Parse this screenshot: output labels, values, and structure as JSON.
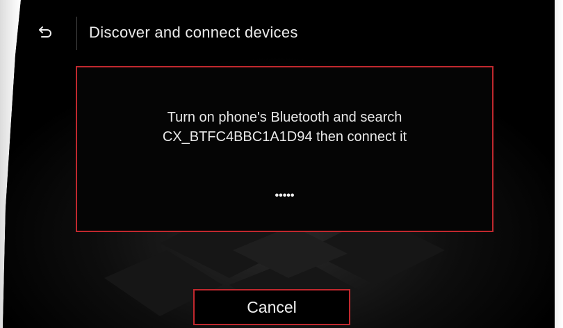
{
  "header": {
    "back_icon": "back-arrow-icon",
    "title": "Discover and connect devices"
  },
  "dialog": {
    "message_line1": "Turn on phone's Bluetooth and search",
    "message_line2": "CX_BTFC4BBC1A1D94 then connect it",
    "progress_indicator": "•••••"
  },
  "actions": {
    "cancel_label": "Cancel"
  },
  "colors": {
    "accent_border": "#c0282e",
    "background": "#000000",
    "text": "#ececec"
  }
}
